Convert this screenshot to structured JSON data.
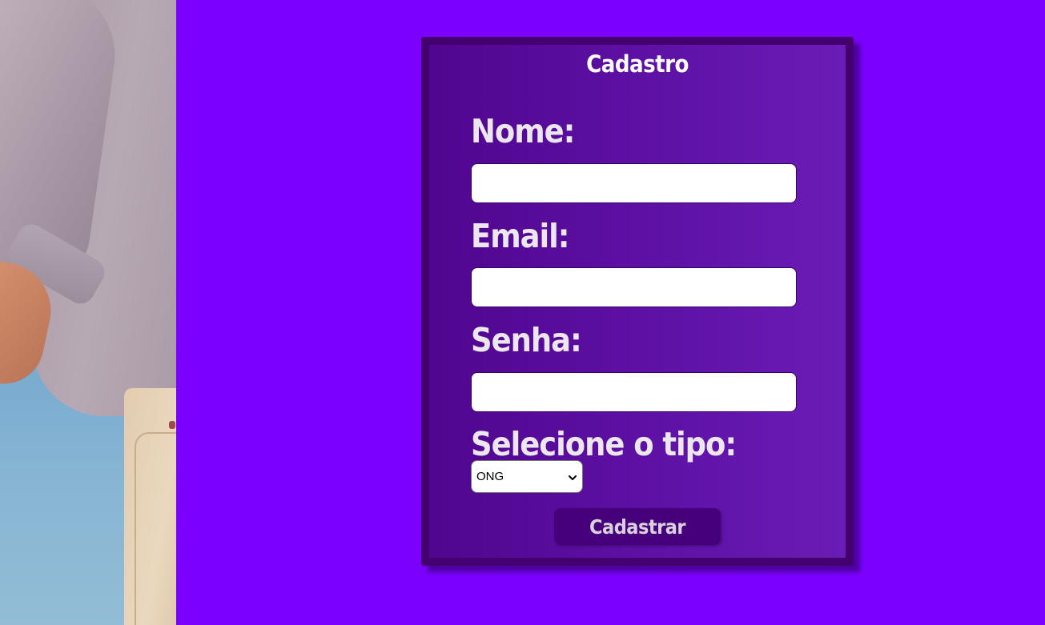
{
  "form": {
    "title": "Cadastro",
    "fields": {
      "name_label": "Nome:",
      "name_value": "",
      "email_label": "Email:",
      "email_value": "",
      "password_label": "Senha:",
      "password_value": "",
      "type_label": "Selecione o tipo:",
      "type_selected": "ONG"
    },
    "submit_label": "Cadastrar"
  },
  "colors": {
    "page_background": "#7b00ff",
    "card_border": "#45006f",
    "card_gradient_start": "#50068f",
    "card_gradient_end": "#6a1cb6",
    "button_background": "#46007a",
    "label_text": "#ece6ef"
  },
  "icons": {
    "select_arrow": "chevron-down-icon"
  }
}
